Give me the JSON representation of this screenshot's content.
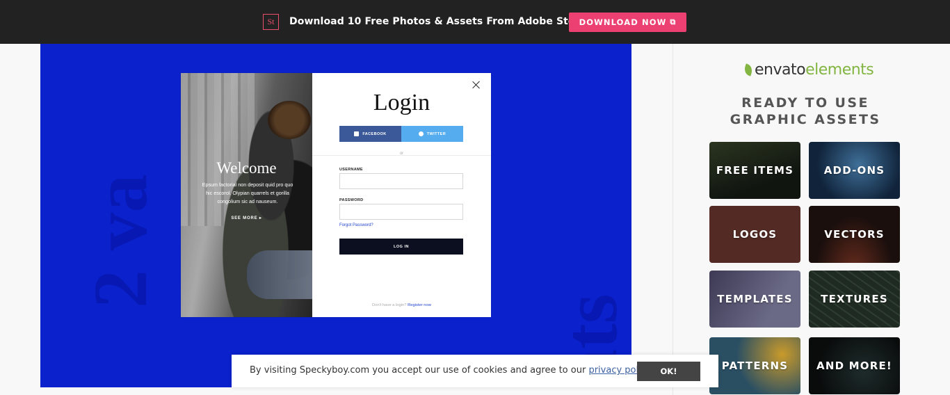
{
  "promo": {
    "logo_text": "St",
    "message": "Download 10 Free Photos & Assets From Adobe Stock",
    "button_label": "DOWNLOAD NOW",
    "button_icon": "external-link-icon",
    "accent_color": "#ec4073"
  },
  "hero": {
    "bg_color": "#0a21cc",
    "bg_word_left": "2 va",
    "bg_word_right": "nts"
  },
  "login_modal": {
    "welcome_title": "Welcome",
    "welcome_body": "Epsum factorial non deposit quid pro quo hic escorol. Olypian quarrels et gorilla congolium sic ad nauseum.",
    "see_more": "SEE MORE ▸",
    "title": "Login",
    "facebook_label": "FACEBOOK",
    "twitter_label": "TWITTER",
    "or_text": "or",
    "username_label": "USERNAME",
    "username_value": "",
    "password_label": "PASSWORD",
    "password_value": "",
    "forgot_link": "Forgot Password?",
    "login_button": "LOG IN",
    "register_prompt": "Don't have a login?",
    "register_link": "Register now"
  },
  "sidebar": {
    "brand_prefix": "envato",
    "brand_suffix": "elements",
    "brand_color": "#82b541",
    "heading_line1": "READY TO USE",
    "heading_line2": "GRAPHIC ASSETS",
    "tiles": [
      {
        "label": "FREE ITEMS"
      },
      {
        "label": "ADD-ONS"
      },
      {
        "label": "LOGOS"
      },
      {
        "label": "VECTORS"
      },
      {
        "label": "TEMPLATES"
      },
      {
        "label": "TEXTURES"
      },
      {
        "label": "PATTERNS"
      },
      {
        "label": "AND MORE!"
      }
    ]
  },
  "cookie": {
    "message": "By visiting Speckyboy.com you accept our use of cookies and agree to our",
    "link": "privacy policy.",
    "ok_label": "OK!"
  }
}
